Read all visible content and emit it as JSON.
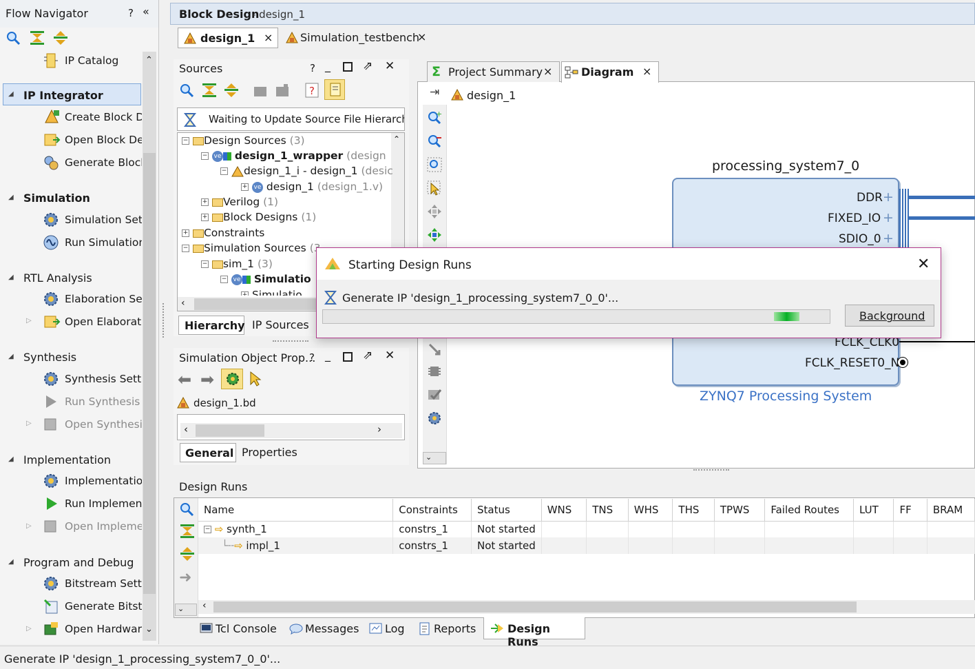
{
  "flow_navigator": {
    "title": "Flow Navigator",
    "help": "?",
    "collapse": "«",
    "ip_catalog": "IP Catalog",
    "sections": {
      "ip_integrator": "IP Integrator",
      "simulation": "Simulation",
      "rtl": "RTL Analysis",
      "synthesis": "Synthesis",
      "implementation": "Implementation",
      "program": "Program and Debug"
    },
    "items": {
      "create_bd": "Create Block De",
      "open_bd": "Open Block Des",
      "generate_block": "Generate Block",
      "sim_settings": "Simulation Setti",
      "run_sim": "Run Simulation",
      "elab_settings": "Elaboration Set",
      "open_elab": "Open Elaborate",
      "synth_settings": "Synthesis Settir",
      "run_synth": "Run Synthesis",
      "open_synth": "Open Synthesiz",
      "impl_settings": "Implementation",
      "run_impl": "Run Implementa",
      "open_impl": "Open Implemen",
      "bit_settings": "Bitstream Settir",
      "gen_bit": "Generate Bitstre",
      "open_hw": "Open Hardware"
    }
  },
  "block_design": {
    "title": "Block Design",
    "subtitle": "- design_1",
    "tabs": [
      "design_1",
      "Simulation_testbench"
    ]
  },
  "sources": {
    "title": "Sources",
    "help": "?",
    "waiting": "Waiting to Update Source File Hierarchy",
    "tree": {
      "design_sources": "Design Sources",
      "design_sources_count": "(3)",
      "wrapper": "design_1_wrapper",
      "wrapper_suffix": "(design",
      "design_1_i": "design_1_i - design_1",
      "design_1_i_suffix": "(desic",
      "design_1_v": "design_1",
      "design_1_v_suffix": "(design_1.v)",
      "verilog": "Verilog",
      "verilog_count": "(1)",
      "block_designs": "Block Designs",
      "block_designs_count": "(1)",
      "constraints": "Constraints",
      "sim_sources": "Simulation Sources",
      "sim_sources_count": "(3",
      "sim_1": "sim_1",
      "sim_1_count": "(3)",
      "simulatio": "Simulatio",
      "simulatio2": "Simulatio"
    },
    "bottom_tabs": [
      "Hierarchy",
      "IP Sources"
    ]
  },
  "sim_props": {
    "title": "Simulation Object Prop...",
    "help": "?",
    "file": "design_1.bd",
    "tabs": [
      "General",
      "Properties"
    ]
  },
  "diagram": {
    "tabs": [
      "Project Summary",
      "Diagram"
    ],
    "breadcrumb": "design_1",
    "block_name": "processing_system7_0",
    "ports": [
      "DDR",
      "FIXED_IO",
      "SDIO_0",
      "FCLK_CLK0",
      "FCLK_RESET0_N"
    ],
    "block_caption": "ZYNQ7 Processing System"
  },
  "dialog": {
    "title": "Starting Design Runs",
    "message": "Generate IP 'design_1_processing_system7_0_0'...",
    "background_button": "Background",
    "close": "✕",
    "progress_fraction": 0.05
  },
  "design_runs": {
    "title": "Design Runs",
    "columns": [
      "Name",
      "Constraints",
      "Status",
      "WNS",
      "TNS",
      "WHS",
      "THS",
      "TPWS",
      "Failed Routes",
      "LUT",
      "FF",
      "BRAM"
    ],
    "rows": [
      {
        "name": "synth_1",
        "constraints": "constrs_1",
        "status": "Not started"
      },
      {
        "name": "impl_1",
        "constraints": "constrs_1",
        "status": "Not started"
      }
    ]
  },
  "bottom_tabs": [
    "Tcl Console",
    "Messages",
    "Log",
    "Reports",
    "Design Runs"
  ],
  "status_bar": "Generate IP 'design_1_processing_system7_0_0'..."
}
